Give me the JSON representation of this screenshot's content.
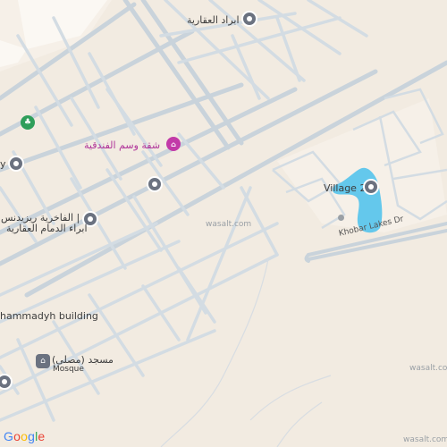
{
  "labels": {
    "ibrad": "ابراد العقارية",
    "hotel": "شقة وسم الفندقية",
    "partial_y": "y",
    "fakhriya_1": "الفاخرية ريزيدنس |",
    "fakhriya_2": "ابراء الدمام العقارية",
    "mhammadyh": "hammadyh building",
    "mosque_ar": "مسجد (مصلى)",
    "mosque_en": "Mosque",
    "village": "Village 2",
    "road": "Khobar Lakes Dr",
    "wasalt": "wasalt.com",
    "corner_wm": "wasalt.com"
  },
  "google_logo": [
    "G",
    "o",
    "o",
    "g",
    "l",
    "e"
  ],
  "colors": {
    "background": "#f2ebe1",
    "road": "#c9d3db",
    "water": "#64c8ec",
    "hotel_accent": "#c23aa8",
    "park": "#2f9e5a",
    "poi_gray": "#6b7280"
  },
  "icons": [
    "place-pin-icon",
    "hotel-icon",
    "park-icon",
    "mosque-icon"
  ]
}
